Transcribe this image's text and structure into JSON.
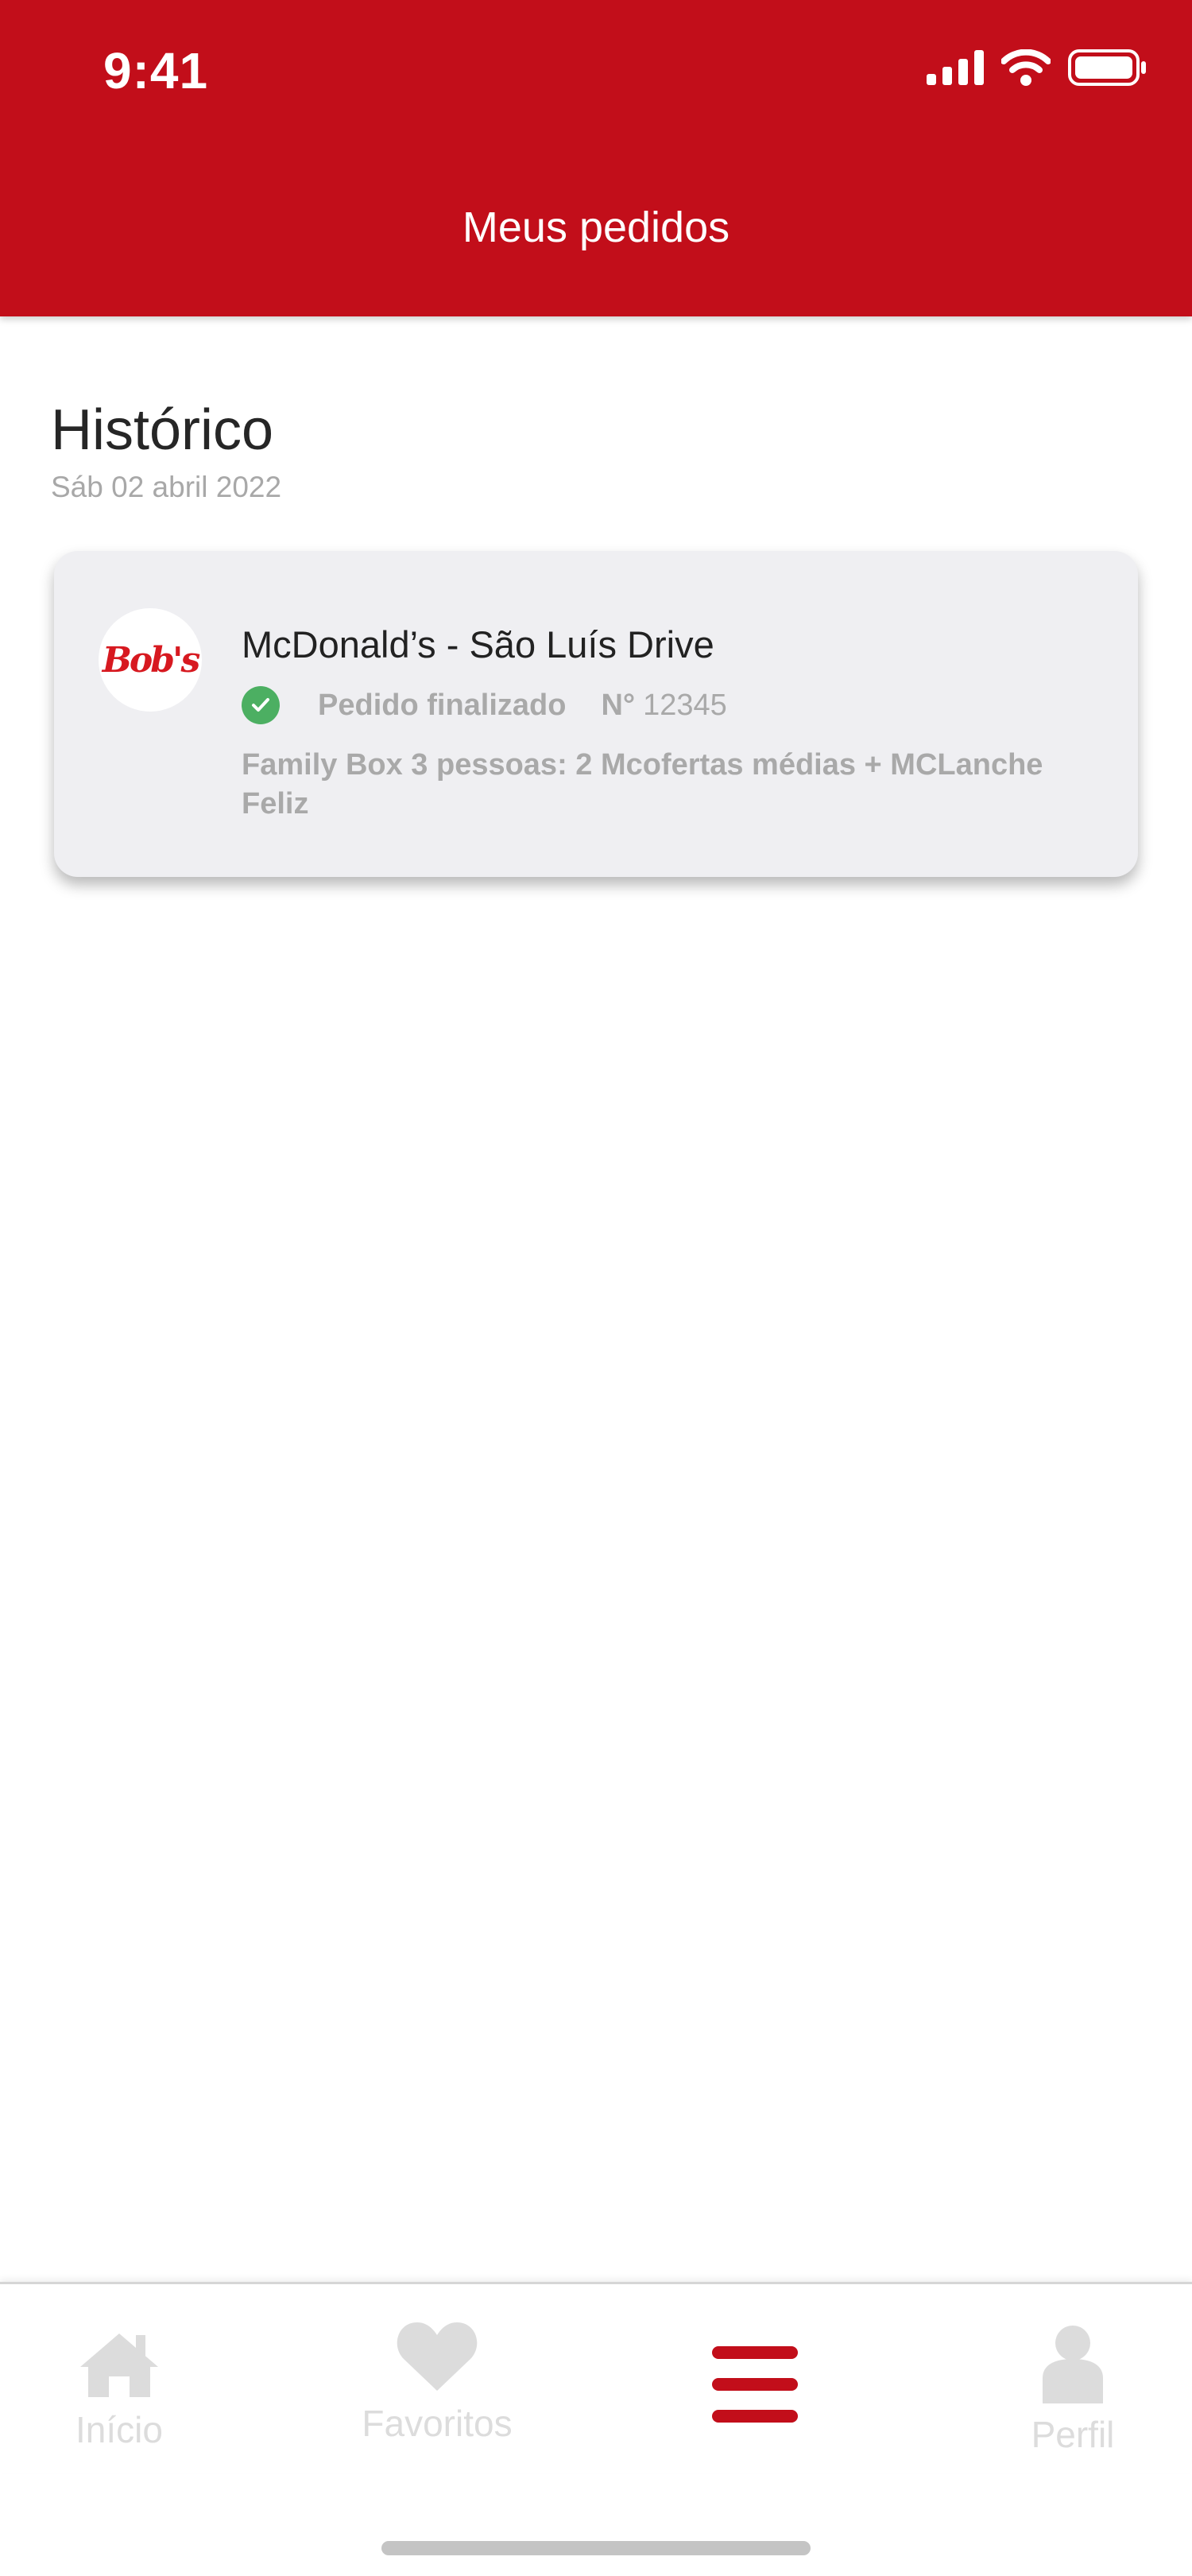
{
  "status_bar": {
    "time": "9:41"
  },
  "header": {
    "title": "Meus pedidos"
  },
  "section": {
    "title": "Histórico",
    "date": "Sáb 02 abril 2022"
  },
  "order": {
    "logo_text": "Bob's",
    "restaurant": "McDonald’s - São Luís Drive",
    "status": "Pedido finalizado",
    "number_label": "N°",
    "number": "12345",
    "description": "Family Box 3 pessoas: 2 Mcofertas médias + MCLanche Feliz"
  },
  "tabs": [
    {
      "label": "Início",
      "icon": "home-icon"
    },
    {
      "label": "Favoritos",
      "icon": "heart-icon"
    },
    {
      "label": "",
      "icon": "menu-icon",
      "active": true
    },
    {
      "label": "Perfil",
      "icon": "person-icon"
    }
  ],
  "colors": {
    "brand": "#c20e1a",
    "success": "#4caf62",
    "inactive": "#dcdcdc"
  }
}
